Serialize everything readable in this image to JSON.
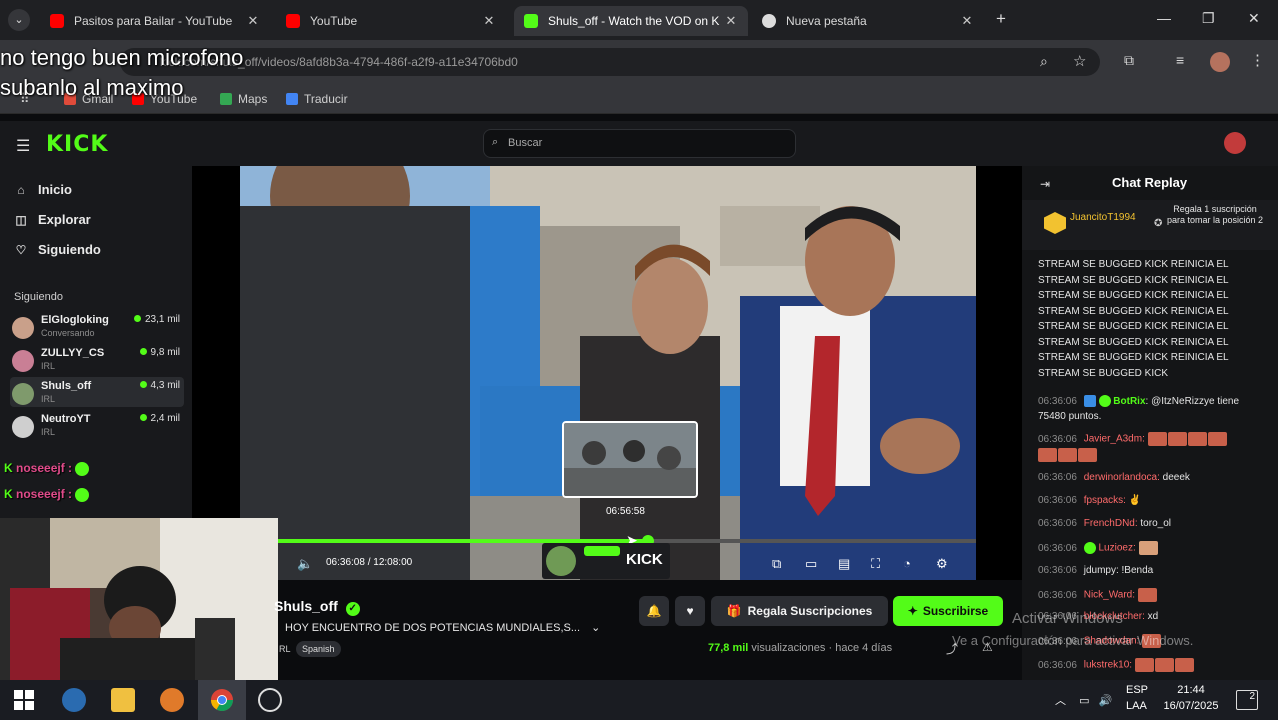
{
  "browser": {
    "tabs": [
      {
        "title": "Pasitos para Bailar - YouTube",
        "color": "#ff0000",
        "active": false
      },
      {
        "title": "YouTube",
        "color": "#ff0000",
        "active": false
      },
      {
        "title": "Shuls_off - Watch the VOD on K",
        "color": "#53fc18",
        "active": true
      },
      {
        "title": "Nueva pestaña",
        "color": "#dcdcdc",
        "active": false
      }
    ],
    "url": "kick.com/shuls_off/videos/8afd8b3a-4794-486f-a2f9-a11e34706bd0",
    "bookmarks": [
      "Gmail",
      "YouTube",
      "Maps",
      "Traducir"
    ]
  },
  "overlay_caption": [
    "no tengo buen microfono",
    "subanlo al maximo"
  ],
  "kick": {
    "logo": "KICK",
    "search_placeholder": "Buscar",
    "nav": [
      {
        "label": "Inicio",
        "icon": "home-icon"
      },
      {
        "label": "Explorar",
        "icon": "compass-icon"
      },
      {
        "label": "Siguiendo",
        "icon": "heart-icon"
      }
    ],
    "following_header": "Siguiendo",
    "following": [
      {
        "name": "ElGlogloking",
        "category": "Conversando",
        "viewers": "23,1 mil",
        "color": "#c9a08a"
      },
      {
        "name": "ZULLYY_CS",
        "category": "IRL",
        "viewers": "9,8 mil",
        "color": "#c97f95"
      },
      {
        "name": "Shuls_off",
        "category": "IRL",
        "viewers": "4,3 mil",
        "color": "#7f9a6c"
      },
      {
        "name": "NeutroYT",
        "category": "IRL",
        "viewers": "2,4 mil",
        "color": "#cfcfcf"
      }
    ],
    "chat_overlay_lines": [
      "noseeejf :",
      "noseeejf :"
    ]
  },
  "player": {
    "time": "06:36:08 / 12:08:00",
    "preview_time": "06:56:58",
    "progress": 0.53,
    "live_tag": "KICK"
  },
  "channel": {
    "name": "Shuls_off",
    "title": "HOY ENCUENTRO DE DOS POTENCIAS MUNDIALES,S...",
    "category": "RL",
    "language": "Spanish",
    "gift_label": "Regala Suscripciones",
    "subscribe_label": "Suscribirse",
    "views": "77,8 mil",
    "views_label": "visualizaciones",
    "age": "hace 4 días"
  },
  "chat": {
    "title": "Chat Replay",
    "pinned_user": "JuancitoT1994",
    "pinned_text": "Regala 1 suscripción para tomar la posición 2",
    "spam_lines": [
      "STREAM SE BUGGED KICK REINICIA EL",
      "STREAM SE BUGGED KICK REINICIA EL",
      "STREAM SE BUGGED KICK REINICIA EL",
      "STREAM SE BUGGED KICK REINICIA EL",
      "STREAM SE BUGGED KICK REINICIA EL",
      "STREAM SE BUGGED KICK REINICIA EL",
      "STREAM SE BUGGED KICK REINICIA EL",
      "STREAM SE BUGGED KICK"
    ],
    "messages": [
      {
        "ts": "06:36:06",
        "user": "BotRix",
        "color": "#53fc18",
        "text": "@ItzNeRizzye tiene 75480 puntos."
      },
      {
        "ts": "06:36:06",
        "user": "Javier_A3dm:",
        "color": "#ff6b6b",
        "text": ""
      },
      {
        "ts": "06:36:06",
        "user": "derwinorlandoca:",
        "color": "#ff6b6b",
        "text": "deeek"
      },
      {
        "ts": "06:36:06",
        "user": "fpspacks:",
        "color": "#ff6b6b",
        "text": ""
      },
      {
        "ts": "06:36:06",
        "user": "FrenchDNd:",
        "color": "#ff6b6b",
        "text": "toro_ol"
      },
      {
        "ts": "06:36:06",
        "user": "Luzioez:",
        "color": "#ff6b6b",
        "text": ""
      },
      {
        "ts": "06:36:06",
        "user": "jdumpy:",
        "color": "#e4e4e4",
        "text": "!Benda"
      },
      {
        "ts": "06:36:06",
        "user": "Nick_Ward:",
        "color": "#ff6b6b",
        "text": ""
      },
      {
        "ts": "06:36:06",
        "user": "blockclutcher:",
        "color": "#ff6b6b",
        "text": "xd"
      },
      {
        "ts": "06:36:06",
        "user": "Shadowdan:",
        "color": "#ff6b6b",
        "text": ""
      },
      {
        "ts": "06:36:06",
        "user": "lukstrek10:",
        "color": "#ff6b6b",
        "text": ""
      }
    ]
  },
  "watermark": [
    "Activar Windows",
    "Ve a Configuración para activar Windows."
  ],
  "taskbar": {
    "lang": "ESP",
    "layout": "LAA",
    "time": "21:44",
    "date": "16/07/2025",
    "notifications": "2"
  }
}
